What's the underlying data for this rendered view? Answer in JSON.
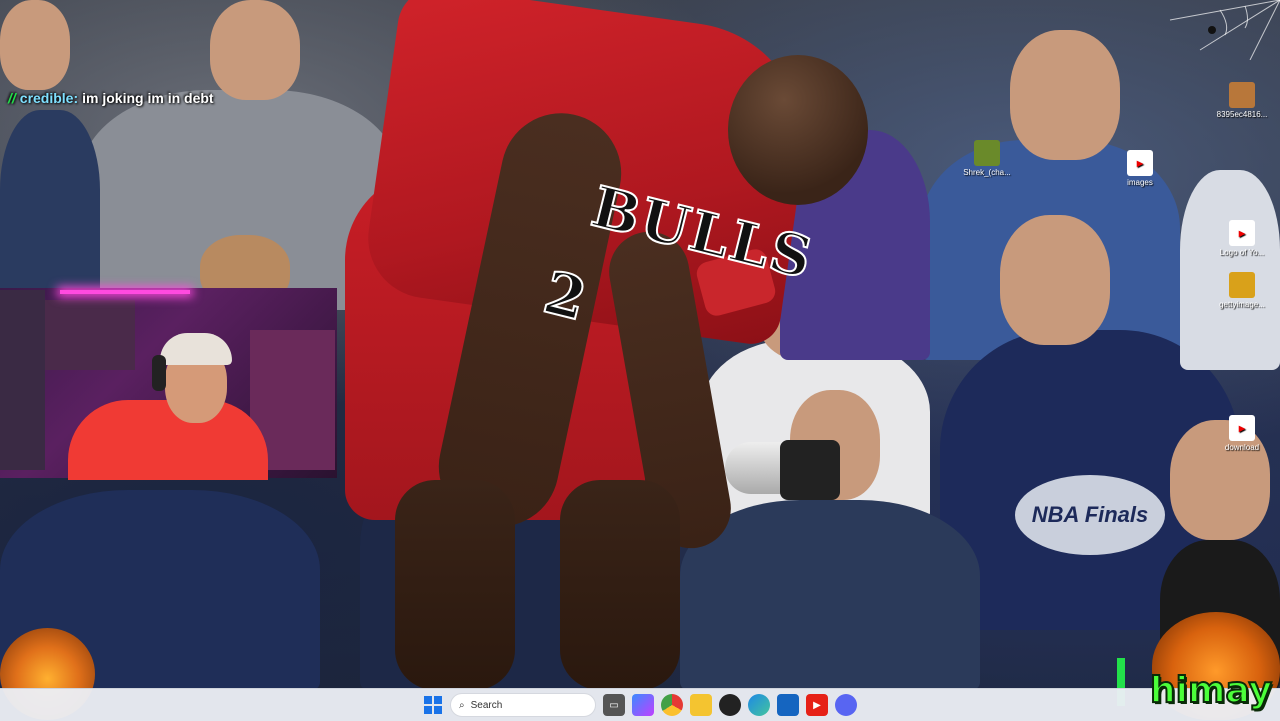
{
  "chat": {
    "badge": "//",
    "username": "credible:",
    "message": "im joking im in debt"
  },
  "wallpaper": {
    "jersey_text": "BULLS",
    "jersey_number": "2",
    "finals_badge": "NBA Finals"
  },
  "desktop_icons": [
    {
      "label": "8395ec4816...",
      "icon": "image-icon"
    },
    {
      "label": "Shrek_(cha...",
      "icon": "shrek-icon"
    },
    {
      "label": "images",
      "icon": "youtube-icon"
    },
    {
      "label": "Logo of Yo...",
      "icon": "youtube-icon"
    },
    {
      "label": "gettyimage...",
      "icon": "image-icon"
    },
    {
      "label": "download",
      "icon": "youtube-icon"
    }
  ],
  "overlay": {
    "streamer_name": "himay"
  },
  "taskbar": {
    "search_placeholder": "Search",
    "apps": [
      "file-explorer",
      "copilot",
      "chrome",
      "folder",
      "obs",
      "edge",
      "store",
      "youtube",
      "discord"
    ]
  },
  "colors": {
    "jersey_red": "#c81e26",
    "chat_green": "#22e04a",
    "himay_green": "#4cff3a",
    "taskbar_bg": "#ebeef5"
  }
}
